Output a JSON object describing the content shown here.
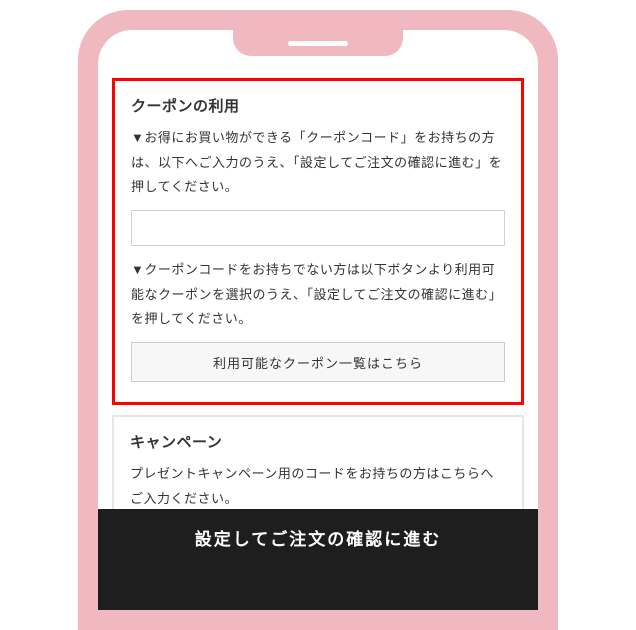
{
  "coupon": {
    "title": "クーポンの利用",
    "body1": "▼お得にお買い物ができる「クーポンコード」をお持ちの方は、以下へご入力のうえ、「設定してご注文の確認に進む」を押してください。",
    "body2": "▼クーポンコードをお持ちでない方は以下ボタンより利用可能なクーポンを選択のうえ、「設定してご注文の確認に進む」を押してください。",
    "list_button_label": "利用可能なクーポン一覧はこちら",
    "input_value": ""
  },
  "campaign": {
    "title": "キャンペーン",
    "body": "プレゼントキャンペーン用のコードをお持ちの方はこちらへご入力ください。",
    "input_value": ""
  },
  "footer": {
    "proceed_label": "設定してご注文の確認に進む"
  }
}
